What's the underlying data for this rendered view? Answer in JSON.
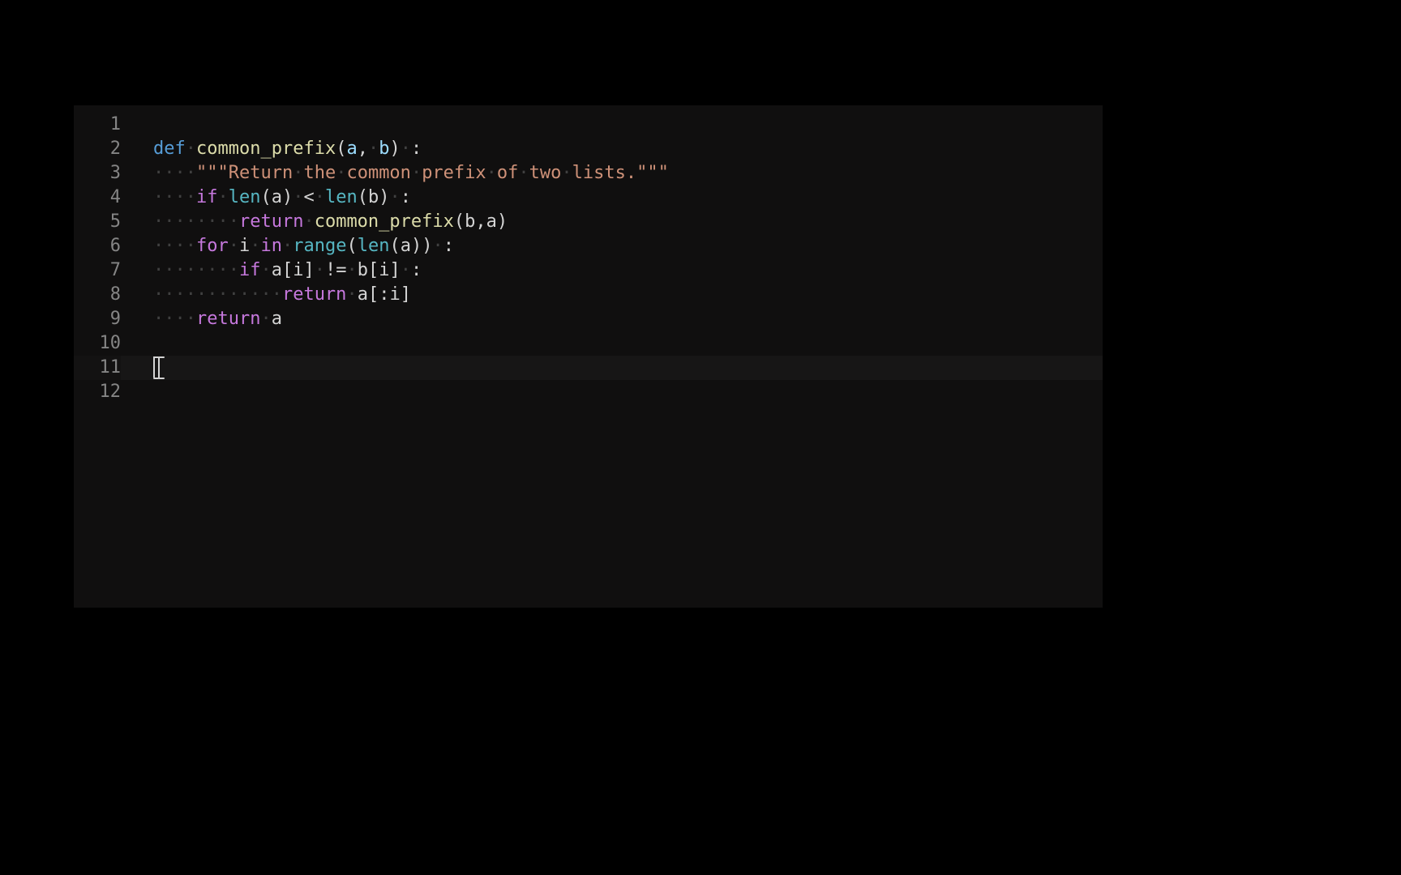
{
  "editor": {
    "cursor_line": 11,
    "lines": [
      {
        "num": "1",
        "tokens": []
      },
      {
        "num": "2",
        "tokens": [
          {
            "t": "def",
            "c": "kw-blue"
          },
          {
            "t": " ",
            "c": "whitespace-dot",
            "dot": true
          },
          {
            "t": "common_prefix",
            "c": "fn"
          },
          {
            "t": "(",
            "c": "punc"
          },
          {
            "t": "a",
            "c": "param"
          },
          {
            "t": ",",
            "c": "punc"
          },
          {
            "t": " ",
            "c": "whitespace-dot",
            "dot": true
          },
          {
            "t": "b",
            "c": "param"
          },
          {
            "t": ")",
            "c": "punc"
          },
          {
            "t": " ",
            "c": "whitespace-dot",
            "dot": true
          },
          {
            "t": ":",
            "c": "punc"
          }
        ]
      },
      {
        "num": "3",
        "tokens": [
          {
            "t": "····",
            "c": "whitespace-dot",
            "dots": 4
          },
          {
            "t": "\"\"\"Return",
            "c": "str"
          },
          {
            "t": " ",
            "c": "whitespace-dot",
            "dot": true,
            "strspace": true
          },
          {
            "t": "the",
            "c": "str"
          },
          {
            "t": " ",
            "c": "whitespace-dot",
            "dot": true,
            "strspace": true
          },
          {
            "t": "common",
            "c": "str"
          },
          {
            "t": " ",
            "c": "whitespace-dot",
            "dot": true,
            "strspace": true
          },
          {
            "t": "prefix",
            "c": "str"
          },
          {
            "t": " ",
            "c": "whitespace-dot",
            "dot": true,
            "strspace": true
          },
          {
            "t": "of",
            "c": "str"
          },
          {
            "t": " ",
            "c": "whitespace-dot",
            "dot": true,
            "strspace": true
          },
          {
            "t": "two",
            "c": "str"
          },
          {
            "t": " ",
            "c": "whitespace-dot",
            "dot": true,
            "strspace": true
          },
          {
            "t": "lists.\"\"\"",
            "c": "str"
          }
        ]
      },
      {
        "num": "4",
        "tokens": [
          {
            "t": "····",
            "c": "whitespace-dot",
            "dots": 4
          },
          {
            "t": "if",
            "c": "kw"
          },
          {
            "t": " ",
            "c": "whitespace-dot",
            "dot": true
          },
          {
            "t": "len",
            "c": "fn2"
          },
          {
            "t": "(",
            "c": "punc"
          },
          {
            "t": "a",
            "c": "var"
          },
          {
            "t": ")",
            "c": "punc"
          },
          {
            "t": " ",
            "c": "whitespace-dot",
            "dot": true
          },
          {
            "t": "<",
            "c": "op"
          },
          {
            "t": " ",
            "c": "whitespace-dot",
            "dot": true
          },
          {
            "t": "len",
            "c": "fn2"
          },
          {
            "t": "(",
            "c": "punc"
          },
          {
            "t": "b",
            "c": "var"
          },
          {
            "t": ")",
            "c": "punc"
          },
          {
            "t": " ",
            "c": "whitespace-dot",
            "dot": true
          },
          {
            "t": ":",
            "c": "punc"
          }
        ]
      },
      {
        "num": "5",
        "tokens": [
          {
            "t": "········",
            "c": "whitespace-dot",
            "dots": 8
          },
          {
            "t": "return",
            "c": "kw"
          },
          {
            "t": " ",
            "c": "whitespace-dot",
            "dot": true
          },
          {
            "t": "common_prefix",
            "c": "fn"
          },
          {
            "t": "(",
            "c": "punc"
          },
          {
            "t": "b",
            "c": "var"
          },
          {
            "t": ",",
            "c": "punc"
          },
          {
            "t": "a",
            "c": "var"
          },
          {
            "t": ")",
            "c": "punc"
          }
        ]
      },
      {
        "num": "6",
        "tokens": [
          {
            "t": "····",
            "c": "whitespace-dot",
            "dots": 4
          },
          {
            "t": "for",
            "c": "kw"
          },
          {
            "t": " ",
            "c": "whitespace-dot",
            "dot": true
          },
          {
            "t": "i",
            "c": "var"
          },
          {
            "t": " ",
            "c": "whitespace-dot",
            "dot": true
          },
          {
            "t": "in",
            "c": "kw"
          },
          {
            "t": " ",
            "c": "whitespace-dot",
            "dot": true
          },
          {
            "t": "range",
            "c": "fn2"
          },
          {
            "t": "(",
            "c": "punc"
          },
          {
            "t": "len",
            "c": "fn2"
          },
          {
            "t": "(",
            "c": "punc"
          },
          {
            "t": "a",
            "c": "var"
          },
          {
            "t": ")",
            "c": "punc"
          },
          {
            "t": ")",
            "c": "punc"
          },
          {
            "t": " ",
            "c": "whitespace-dot",
            "dot": true
          },
          {
            "t": ":",
            "c": "punc"
          }
        ]
      },
      {
        "num": "7",
        "tokens": [
          {
            "t": "········",
            "c": "whitespace-dot",
            "dots": 8
          },
          {
            "t": "if",
            "c": "kw"
          },
          {
            "t": " ",
            "c": "whitespace-dot",
            "dot": true
          },
          {
            "t": "a",
            "c": "var"
          },
          {
            "t": "[",
            "c": "punc"
          },
          {
            "t": "i",
            "c": "var"
          },
          {
            "t": "]",
            "c": "punc"
          },
          {
            "t": " ",
            "c": "whitespace-dot",
            "dot": true
          },
          {
            "t": "!=",
            "c": "op"
          },
          {
            "t": " ",
            "c": "whitespace-dot",
            "dot": true
          },
          {
            "t": "b",
            "c": "var"
          },
          {
            "t": "[",
            "c": "punc"
          },
          {
            "t": "i",
            "c": "var"
          },
          {
            "t": "]",
            "c": "punc"
          },
          {
            "t": " ",
            "c": "whitespace-dot",
            "dot": true
          },
          {
            "t": ":",
            "c": "punc"
          }
        ]
      },
      {
        "num": "8",
        "tokens": [
          {
            "t": "············",
            "c": "whitespace-dot",
            "dots": 12
          },
          {
            "t": "return",
            "c": "kw"
          },
          {
            "t": " ",
            "c": "whitespace-dot",
            "dot": true
          },
          {
            "t": "a",
            "c": "var"
          },
          {
            "t": "[",
            "c": "punc"
          },
          {
            "t": ":",
            "c": "punc"
          },
          {
            "t": "i",
            "c": "var"
          },
          {
            "t": "]",
            "c": "punc"
          }
        ]
      },
      {
        "num": "9",
        "tokens": [
          {
            "t": "····",
            "c": "whitespace-dot",
            "dots": 4
          },
          {
            "t": "return",
            "c": "kw"
          },
          {
            "t": " ",
            "c": "whitespace-dot",
            "dot": true
          },
          {
            "t": "a",
            "c": "var"
          }
        ]
      },
      {
        "num": "10",
        "tokens": []
      },
      {
        "num": "11",
        "tokens": [],
        "has_cursor": true,
        "has_caret_icon": true
      },
      {
        "num": "12",
        "tokens": []
      }
    ]
  }
}
